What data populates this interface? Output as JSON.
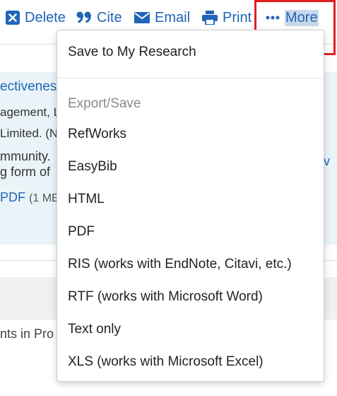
{
  "toolbar": {
    "delete": "Delete",
    "cite": "Cite",
    "email": "Email",
    "print": "Print",
    "more": "More"
  },
  "record": {
    "title_fragment": "ectivenes",
    "right_fragment": "v",
    "line1": "agement, L",
    "line2": "Limited. (N",
    "line3": "mmunity.",
    "line4": "g form of",
    "pdf_link": "PDF",
    "pdf_meta": "(1 ME"
  },
  "bottom_fragment": "nts in Pro",
  "menu": {
    "save": "Save to My Research",
    "export_header": "Export/Save",
    "items": [
      "RefWorks",
      "EasyBib",
      "HTML",
      "PDF",
      "RIS (works with EndNote, Citavi, etc.)",
      "RTF (works with Microsoft Word)",
      "Text only",
      "XLS (works with Microsoft Excel)"
    ]
  },
  "colors": {
    "link": "#1f65b7",
    "highlight": "#e02020",
    "card_bg": "#eaf4f8"
  }
}
